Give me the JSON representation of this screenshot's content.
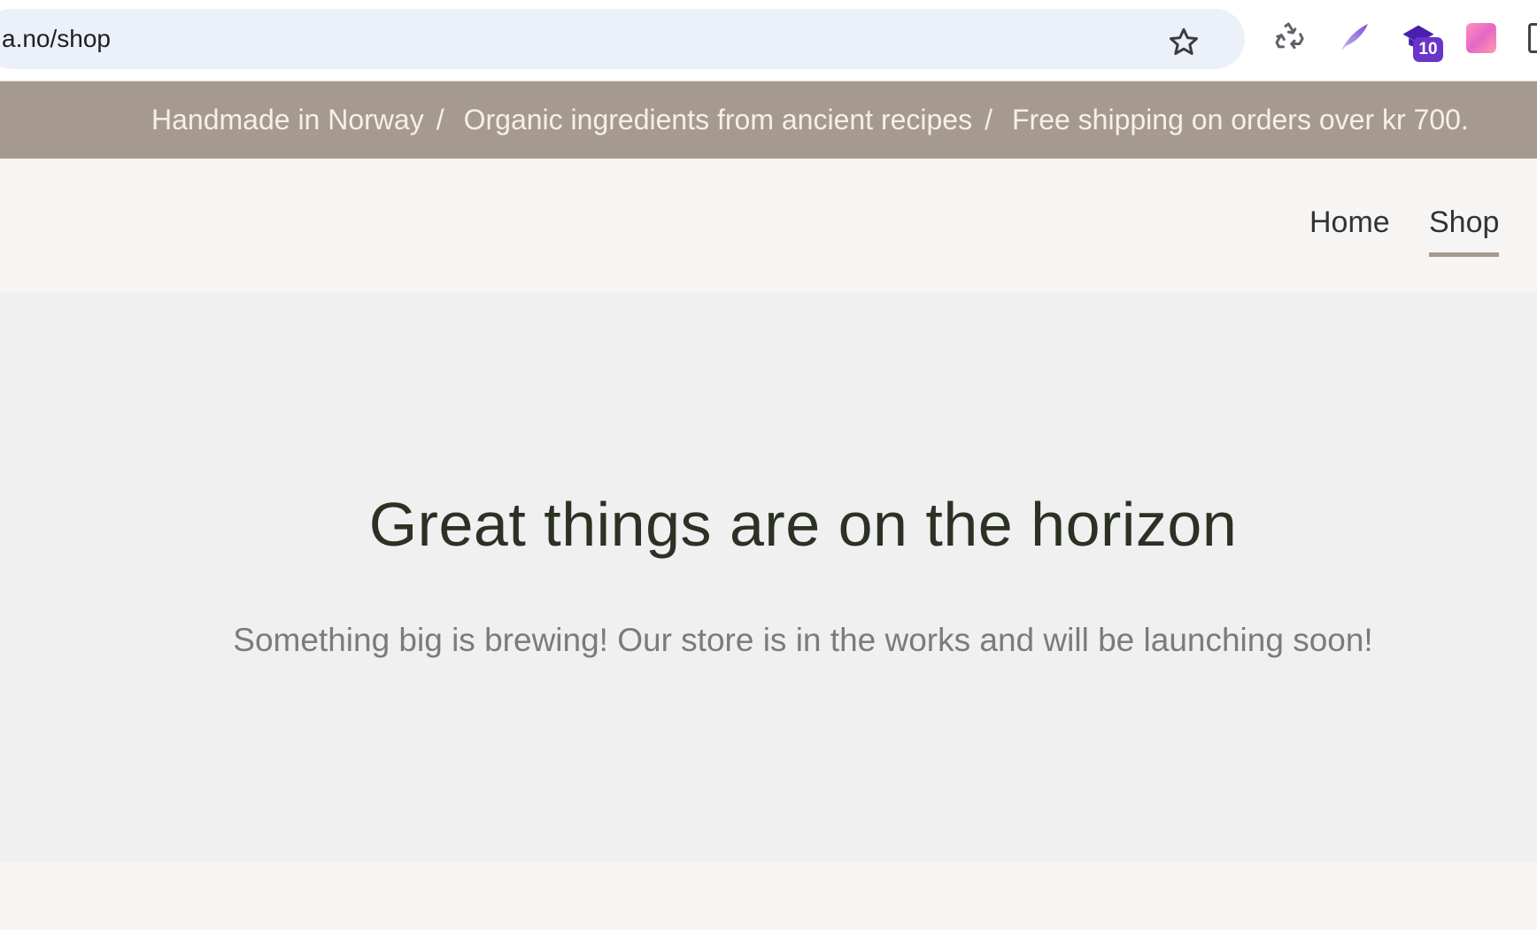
{
  "browser": {
    "url": "a.no/shop",
    "bookmark_icon": "star-icon",
    "extensions": [
      {
        "icon": "recycle-icon"
      },
      {
        "icon": "quill-icon"
      },
      {
        "icon": "graduation-cap-icon",
        "badge": "10"
      },
      {
        "icon": "pink-gradient-icon"
      },
      {
        "icon": "partial-extension-icon"
      }
    ]
  },
  "announcement": {
    "items": [
      "Handmade in Norway",
      "Organic ingredients from ancient recipes",
      "Free shipping on orders over kr 700."
    ],
    "separator": "/",
    "color": "#a69a8e"
  },
  "nav": {
    "home": "Home",
    "shop": "Shop",
    "active": "Shop"
  },
  "main": {
    "headline": "Great things are on the horizon",
    "subline": "Something big is brewing! Our store is in the works and will be launching soon!"
  },
  "colors": {
    "headline": "#2c3223",
    "accent": "#a69a8e",
    "badge": "#6a35c9"
  }
}
